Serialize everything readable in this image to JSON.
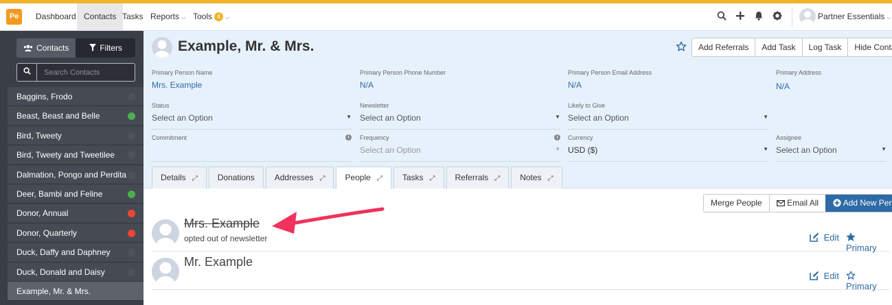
{
  "nav": {
    "logo": "Pe",
    "items": [
      {
        "label": "Dashboard"
      },
      {
        "label": "Contacts"
      },
      {
        "label": "Tasks"
      },
      {
        "label": "Reports"
      },
      {
        "label": "Tools",
        "badge": "4"
      }
    ],
    "user_name": "Partner Essentials",
    "icons": [
      "search-icon",
      "plus-icon",
      "bell-icon",
      "gear-icon"
    ],
    "accent_color": "#f0b429"
  },
  "sidebar": {
    "toggle": {
      "contacts_label": "Contacts",
      "filters_label": "Filters"
    },
    "search_placeholder": "Search Contacts",
    "contacts": [
      {
        "name": "Baggins, Frodo",
        "status": "none"
      },
      {
        "name": "Beast, Beast and Belle",
        "status": "green"
      },
      {
        "name": "Bird, Tweety",
        "status": "none"
      },
      {
        "name": "Bird, Tweety and Tweetilee",
        "status": "none"
      },
      {
        "name": "Dalmation, Pongo and Perdita",
        "status": "none"
      },
      {
        "name": "Deer, Bambi and Feline",
        "status": "green"
      },
      {
        "name": "Donor, Annual",
        "status": "red"
      },
      {
        "name": "Donor, Quarterly",
        "status": "red"
      },
      {
        "name": "Duck, Daffy and Daphney",
        "status": "none"
      },
      {
        "name": "Duck, Donald and Daisy",
        "status": "none"
      },
      {
        "name": "Example, Mr. & Mrs.",
        "status": "selected"
      }
    ],
    "status_colors": {
      "green": "#4caf50",
      "red": "#f44336",
      "none": "#4e535a"
    }
  },
  "contact": {
    "title": "Example, Mr. & Mrs.",
    "buttons": {
      "add_referrals": "Add Referrals",
      "add_task": "Add Task",
      "log_task": "Log Task",
      "hide_contact": "Hide Contact"
    },
    "fields": {
      "primary_person_name": {
        "label": "Primary Person Name",
        "value": "Mrs. Example"
      },
      "primary_phone": {
        "label": "Primary Person Phone Number",
        "value": "N/A"
      },
      "primary_email": {
        "label": "Primary Person Email Address",
        "value": "N/A"
      },
      "primary_address": {
        "label": "Primary Address",
        "value": "N/A"
      },
      "status": {
        "label": "Status",
        "value": "Select an Option"
      },
      "newsletter": {
        "label": "Newsletter",
        "value": "Select an Option"
      },
      "likely_to_give": {
        "label": "Likely to Give",
        "value": "Select an Option"
      },
      "commitment": {
        "label": "Commitment",
        "value": ""
      },
      "frequency": {
        "label": "Frequency",
        "value": "Select an Option"
      },
      "currency": {
        "label": "Currency",
        "value": "USD ($)"
      },
      "assignee": {
        "label": "Assignee",
        "value": "Select an Option"
      }
    }
  },
  "tabs": [
    {
      "label": "Details",
      "expand": true
    },
    {
      "label": "Donations",
      "expand": false
    },
    {
      "label": "Addresses",
      "expand": true
    },
    {
      "label": "People",
      "expand": true,
      "active": true
    },
    {
      "label": "Tasks",
      "expand": true
    },
    {
      "label": "Referrals",
      "expand": true
    },
    {
      "label": "Notes",
      "expand": true
    }
  ],
  "people_panel": {
    "merge_label": "Merge People",
    "email_all_label": "Email All",
    "add_new_label": "Add New Person",
    "people": [
      {
        "name": "Mrs. Example",
        "note": "opted out of newsletter",
        "struck": true,
        "edit_label": "Edit",
        "primary_label": "Primary",
        "is_primary": true
      },
      {
        "name": "Mr. Example",
        "note": "",
        "struck": false,
        "edit_label": "Edit",
        "primary_label": "Primary",
        "is_primary": false
      }
    ],
    "link_color": "#2d6aa6",
    "annotation_arrow_color": "#f0325c"
  }
}
